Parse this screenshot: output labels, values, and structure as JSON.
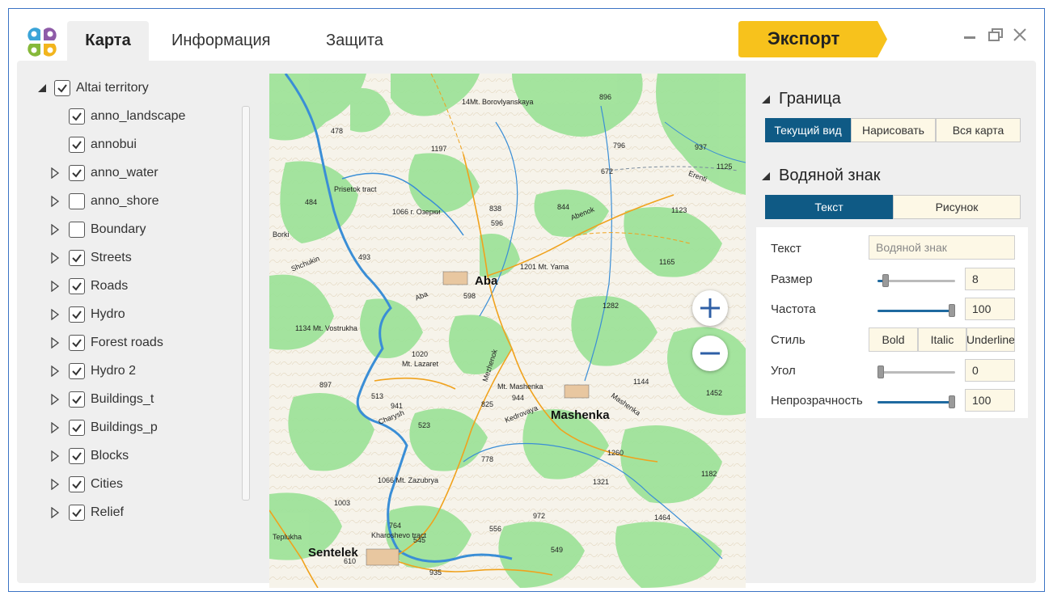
{
  "tabs": [
    "Карта",
    "Информация",
    "Защита"
  ],
  "export_label": "Экспорт",
  "colors": {
    "accent": "#0f5a85",
    "export": "#f7c21c",
    "window_border": "#3b73c4"
  },
  "layers": {
    "root": "Altai territory",
    "items": [
      {
        "label": "anno_landscape",
        "checked": true,
        "expandable": false
      },
      {
        "label": "annobui",
        "checked": true,
        "expandable": false
      },
      {
        "label": "anno_water",
        "checked": true,
        "expandable": true
      },
      {
        "label": "anno_shore",
        "checked": false,
        "expandable": true
      },
      {
        "label": "Boundary",
        "checked": false,
        "expandable": true
      },
      {
        "label": "Streets",
        "checked": true,
        "expandable": true
      },
      {
        "label": "Roads",
        "checked": true,
        "expandable": true
      },
      {
        "label": "Hydro",
        "checked": true,
        "expandable": true
      },
      {
        "label": "Forest roads",
        "checked": true,
        "expandable": true
      },
      {
        "label": "Hydro 2",
        "checked": true,
        "expandable": true
      },
      {
        "label": "Buildings_t",
        "checked": true,
        "expandable": true
      },
      {
        "label": "Buildings_p",
        "checked": true,
        "expandable": true
      },
      {
        "label": "Blocks",
        "checked": true,
        "expandable": true
      },
      {
        "label": "Cities",
        "checked": true,
        "expandable": true
      },
      {
        "label": "Relief",
        "checked": true,
        "expandable": true
      }
    ]
  },
  "map": {
    "labels": {
      "aba": "Aba",
      "mashenka": "Mashenka",
      "sentelek": "Sentelek",
      "borovlyanskaya": "14Mt. Borovlyanskaya",
      "n896": "896",
      "n478": "478",
      "n1197": "1197",
      "n796": "796",
      "n937": "937",
      "n672": "672",
      "n1125": "1125",
      "prisetok": "Prisetok tract",
      "n484": "484",
      "ozerki": "1066 г. Озерки",
      "n838": "838",
      "n596": "596",
      "n844": "844",
      "abenok": "Abenok",
      "n1123": "1123",
      "erenti": "Erenti",
      "borki": "Borki",
      "shchukin": "Shchukin",
      "n493": "493",
      "yama": "1201 Mt. Yama",
      "n1165": "1165",
      "n598": "598",
      "aba_river": "Aba",
      "n1282": "1282",
      "vostrukha": "1134 Mt. Vostrukha",
      "n1020": "1020",
      "lazaret": "Mt. Lazaret",
      "mezhenok": "Mezhenok",
      "n897": "897",
      "mt_mashenka": "Mt. Mashenka",
      "n944": "944",
      "n1144": "1144",
      "n1452": "1452",
      "n513": "513",
      "n941": "941",
      "charysh": "Charysh",
      "n523": "523",
      "n825": "825",
      "kedrovaya": "Kedrovaya",
      "mashenka_river": "Mashenka",
      "n778": "778",
      "n1260": "1260",
      "n1182": "1182",
      "zazubrya": "1066 Mt. Zazubrya",
      "n1321": "1321",
      "n1003": "1003",
      "n972": "972",
      "n1464": "1464",
      "n764": "764",
      "n556": "556",
      "teplukha": "Teplukha",
      "kharosh": "Kharoshevo tract",
      "n545": "545",
      "n549": "549",
      "n935": "935",
      "n610": "610"
    }
  },
  "border": {
    "title": "Граница",
    "buttons": [
      "Текущий вид",
      "Нарисовать",
      "Вся карта"
    ],
    "active": 0
  },
  "watermark": {
    "title": "Водяной знак",
    "tabs": [
      "Текст",
      "Рисунок"
    ],
    "active": 0,
    "props": {
      "text_label": "Текст",
      "text_placeholder": "Водяной знак",
      "size_label": "Размер",
      "size_value": "8",
      "size_fraction": 0.1,
      "freq_label": "Частота",
      "freq_value": "100",
      "freq_fraction": 1.0,
      "style_label": "Стиль",
      "styles": [
        "Bold",
        "Italic",
        "Underline"
      ],
      "angle_label": "Угол",
      "angle_value": "0",
      "angle_fraction": 0.0,
      "opacity_label": "Непрозрачность",
      "opacity_value": "100",
      "opacity_fraction": 1.0
    }
  }
}
